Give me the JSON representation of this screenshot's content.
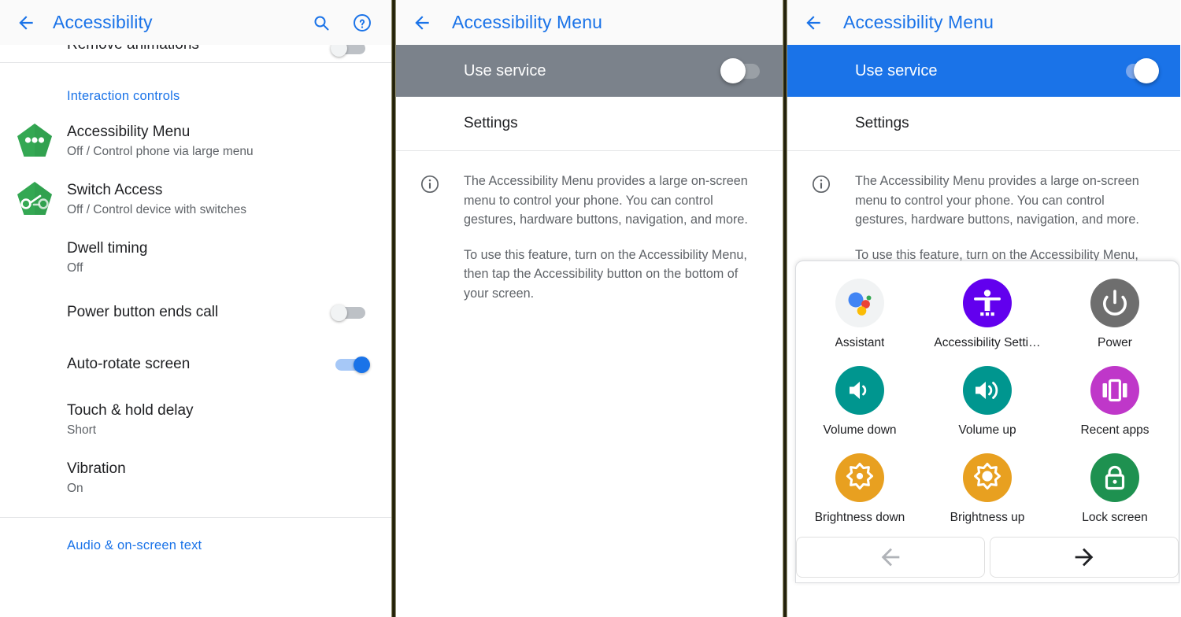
{
  "panel1": {
    "appbar": {
      "title": "Accessibility",
      "back_icon": "back-arrow-icon",
      "search_icon": "search-icon",
      "help_icon": "help-circle-icon"
    },
    "clipped_item": {
      "label": "Remove animations",
      "toggle": "off"
    },
    "section_title": "Interaction controls",
    "items": [
      {
        "title": "Accessibility Menu",
        "subtitle": "Off / Control phone via large menu",
        "icon": "accessibility-menu-pentagon-icon",
        "control": "none"
      },
      {
        "title": "Switch Access",
        "subtitle": "Off / Control device with switches",
        "icon": "switch-access-pentagon-icon",
        "control": "none"
      },
      {
        "title": "Dwell timing",
        "subtitle": "Off",
        "icon": "",
        "control": "none"
      },
      {
        "title": "Power button ends call",
        "subtitle": "",
        "icon": "",
        "control": "toggle-off"
      },
      {
        "title": "Auto-rotate screen",
        "subtitle": "",
        "icon": "",
        "control": "toggle-on"
      },
      {
        "title": "Touch & hold delay",
        "subtitle": "Short",
        "icon": "",
        "control": "none"
      },
      {
        "title": "Vibration",
        "subtitle": "On",
        "icon": "",
        "control": "none"
      }
    ],
    "bottom_link": "Audio & on-screen text"
  },
  "panel2": {
    "appbar": {
      "title": "Accessibility Menu",
      "back_icon": "back-arrow-icon"
    },
    "service": {
      "label": "Use service",
      "state": "off"
    },
    "settings_label": "Settings",
    "description": {
      "info_icon": "info-circle-icon",
      "paragraph1": "The Accessibility Menu provides a large on-screen menu to control your phone. You can control gestures, hardware buttons, navigation, and more.",
      "paragraph2": "To use this feature, turn on the Accessibility Menu, then tap the Accessibility button on the bottom of your screen."
    }
  },
  "panel3": {
    "appbar": {
      "title": "Accessibility Menu",
      "back_icon": "back-arrow-icon"
    },
    "service": {
      "label": "Use service",
      "state": "on"
    },
    "settings_label": "Settings",
    "description": {
      "info_icon": "info-circle-icon",
      "paragraph1": "The Accessibility Menu provides a large on-screen menu to control your phone. You can control gestures, hardware buttons, navigation, and more.",
      "paragraph2": "To use this feature, turn on the Accessibility Menu, then tap the Accessibility button on the bottom of"
    },
    "a11y_menu": {
      "items": [
        {
          "label": "Assistant",
          "icon": "google-assistant-icon",
          "color": "#f1f3f4"
        },
        {
          "label": "Accessibility Setti…",
          "icon": "accessibility-person-icon",
          "color": "#6200ee"
        },
        {
          "label": "Power",
          "icon": "power-icon",
          "color": "#6e6e6e"
        },
        {
          "label": "Volume down",
          "icon": "volume-down-icon",
          "color": "#00968f"
        },
        {
          "label": "Volume up",
          "icon": "volume-up-icon",
          "color": "#00968f"
        },
        {
          "label": "Recent apps",
          "icon": "recent-apps-icon",
          "color": "#bf37c9"
        },
        {
          "label": "Brightness down",
          "icon": "brightness-down-icon",
          "color": "#e8a020"
        },
        {
          "label": "Brightness up",
          "icon": "brightness-up-icon",
          "color": "#e8a020"
        },
        {
          "label": "Lock screen",
          "icon": "lock-icon",
          "color": "#1e9150"
        }
      ],
      "nav": {
        "prev_icon": "arrow-left-icon",
        "next_icon": "arrow-right-icon",
        "prev_enabled": "false",
        "next_enabled": "true"
      }
    }
  },
  "colors": {
    "accent_blue": "#1a73e8",
    "service_off_gray": "#7b828b",
    "text_primary": "#202124",
    "text_secondary": "#5f6368"
  }
}
